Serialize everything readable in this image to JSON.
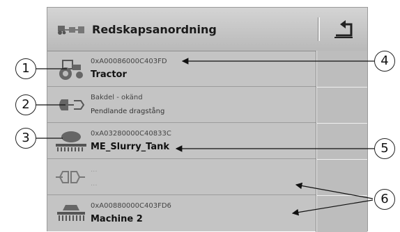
{
  "header": {
    "title": "Redskapsanordning",
    "tree_icon": "implement-tree-icon",
    "back_icon": "return-arrow-icon"
  },
  "rows": [
    {
      "icon": "tractor-icon",
      "line1": "0xA00086000C403FD",
      "line2": "Tractor"
    },
    {
      "icon": "connection-plug-icon",
      "line1": "Bakdel - okänd",
      "line2": "Pendlande dragstång"
    },
    {
      "icon": "slurry-tank-icon",
      "line1": "0xA03280000C40833C",
      "line2": "ME_Slurry_Tank"
    },
    {
      "icon": "coupling-icon",
      "line1": "...",
      "line2": "..."
    },
    {
      "icon": "seeder-icon",
      "line1": "0xA00880000C403FD6",
      "line2": "Machine 2"
    }
  ],
  "callouts": [
    "1",
    "2",
    "3",
    "4",
    "5",
    "6"
  ],
  "colors": {
    "panel": "#c4c4c4",
    "header": "#c8c8c8",
    "text": "#111111"
  }
}
